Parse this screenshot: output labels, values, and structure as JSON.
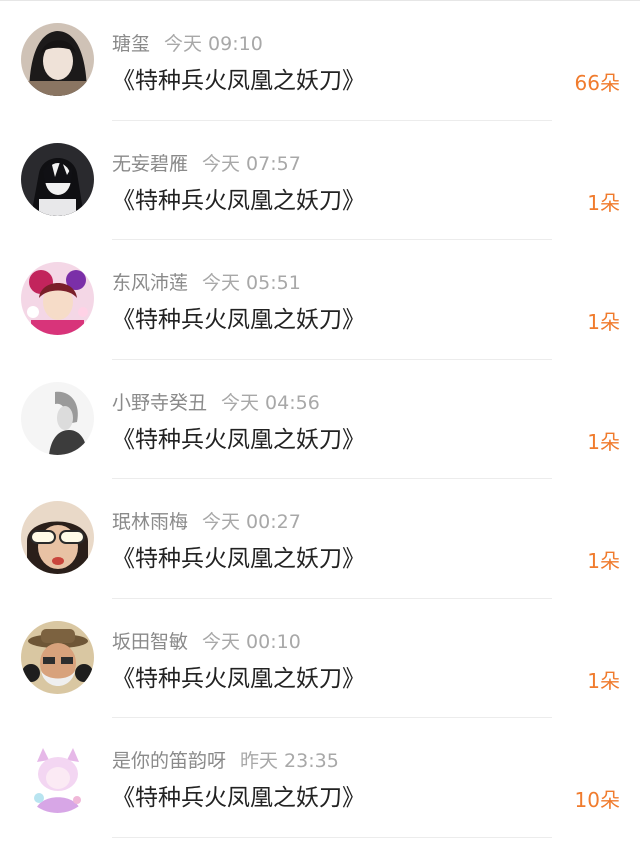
{
  "accent_color": "#f07b2d",
  "rows": [
    {
      "name": "瑭玺",
      "time": "今天  09:10",
      "title": "《特种兵火凤凰之妖刀》",
      "gift": "66朵",
      "avatar": "avatar-photo-icon"
    },
    {
      "name": "无妄碧雁",
      "time": "今天  07:57",
      "title": "《特种兵火凤凰之妖刀》",
      "gift": "1朵",
      "avatar": "avatar-anime-icon"
    },
    {
      "name": "东风沛莲",
      "time": "今天  05:51",
      "title": "《特种兵火凤凰之妖刀》",
      "gift": "1朵",
      "avatar": "avatar-anime-icon"
    },
    {
      "name": "小野寺癸丑",
      "time": "今天  04:56",
      "title": "《特种兵火凤凰之妖刀》",
      "gift": "1朵",
      "avatar": "avatar-photo-icon"
    },
    {
      "name": "珉林雨梅",
      "time": "今天  00:27",
      "title": "《特种兵火凤凰之妖刀》",
      "gift": "1朵",
      "avatar": "avatar-photo-icon"
    },
    {
      "name": "坂田智敏",
      "time": "今天  00:10",
      "title": "《特种兵火凤凰之妖刀》",
      "gift": "1朵",
      "avatar": "avatar-photo-icon"
    },
    {
      "name": "是你的笛韵呀",
      "time": "昨天  23:35",
      "title": "《特种兵火凤凰之妖刀》",
      "gift": "10朵",
      "avatar": "avatar-anime-icon"
    }
  ]
}
